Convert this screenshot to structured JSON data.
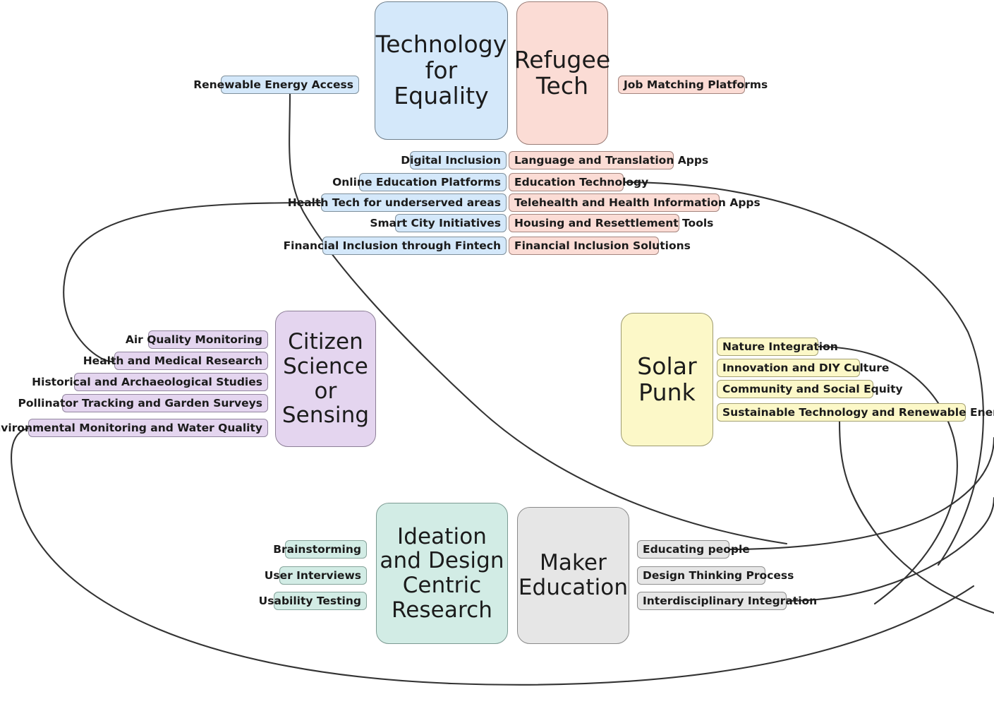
{
  "diagram": {
    "type": "mindmap",
    "background": "#ffffff",
    "edge_color": "#333333"
  },
  "palette": {
    "blue_fill": "#d4e8fa",
    "blue_stroke": "#6f7f8c",
    "pink_fill": "#fbdcd5",
    "pink_stroke": "#9a7d77",
    "purple_fill": "#e4d5ef",
    "purple_stroke": "#8d7f97",
    "yellow_fill": "#fcf8c8",
    "yellow_stroke": "#9d9a6f",
    "teal_fill": "#d2ece5",
    "teal_stroke": "#7c9a92",
    "grey_fill": "#e6e6e6",
    "grey_stroke": "#8a8a8a"
  },
  "branches": [
    {
      "id": "technology-for-equality",
      "title": "Technology\nfor\nEquality",
      "title_lines": [
        "Technology",
        "for",
        "Equality"
      ],
      "color": "blue",
      "leaves": [
        "Renewable Energy Access",
        "Digital Inclusion",
        "Online Education Platforms",
        "Health Tech for underserved areas",
        "Smart City Initiatives",
        "Financial Inclusion through Fintech"
      ]
    },
    {
      "id": "refugee-tech",
      "title_lines": [
        "Refugee",
        "Tech"
      ],
      "color": "pink",
      "leaves": [
        "Job Matching Platforms",
        "Language and Translation Apps",
        "Education Technology",
        "Telehealth and Health Information Apps",
        "Housing and Resettlement Tools",
        "Financial Inclusion Solutions"
      ]
    },
    {
      "id": "citizen-science-or-sensing",
      "title_lines": [
        "Citizen",
        "Science",
        "or",
        "Sensing"
      ],
      "color": "purple",
      "leaves": [
        "Air Quality Monitoring",
        "Health and Medical Research",
        "Historical and Archaeological Studies",
        "Pollinator Tracking and Garden Surveys",
        "Environmental Monitoring and Water Quality"
      ]
    },
    {
      "id": "solar-punk",
      "title_lines": [
        "Solar",
        "Punk"
      ],
      "color": "yellow",
      "leaves": [
        "Nature Integration",
        "Innovation and DIY Culture",
        "Community and Social Equity",
        "Sustainable Technology and Renewable Energy"
      ]
    },
    {
      "id": "ideation-and-design-centric-research",
      "title_lines": [
        "Ideation",
        "and Design",
        "Centric",
        "Research"
      ],
      "color": "teal",
      "leaves": [
        "Brainstorming",
        "User Interviews",
        "Usability Testing"
      ]
    },
    {
      "id": "maker-education",
      "title_lines": [
        "Maker",
        "Education"
      ],
      "color": "grey",
      "leaves": [
        "Educating people",
        "Design Thinking Process",
        "Interdisciplinary Integration"
      ]
    }
  ],
  "nodes": {
    "tech_for_equality": {
      "lines": [
        "Technology",
        "for",
        "Equality"
      ]
    },
    "refugee_tech": {
      "lines": [
        "Refugee",
        "Tech"
      ]
    },
    "citizen_science": {
      "lines": [
        "Citizen",
        "Science",
        "or",
        "Sensing"
      ]
    },
    "solar_punk": {
      "lines": [
        "Solar",
        "Punk"
      ]
    },
    "ideation": {
      "lines": [
        "Ideation",
        "and Design",
        "Centric",
        "Research"
      ]
    },
    "maker_education": {
      "lines": [
        "Maker",
        "Education"
      ]
    }
  },
  "leaves": {
    "renewable_energy_access": "Renewable Energy Access",
    "digital_inclusion": "Digital Inclusion",
    "online_education_platforms": "Online Education Platforms",
    "health_tech_underserved": "Health Tech for underserved areas",
    "smart_city_initiatives": "Smart City Initiatives",
    "financial_inclusion_fintech": "Financial Inclusion through Fintech",
    "job_matching_platforms": "Job Matching Platforms",
    "language_translation_apps": "Language and Translation Apps",
    "education_technology": "Education Technology",
    "telehealth_health_info_apps": "Telehealth and Health Information Apps",
    "housing_resettlement_tools": "Housing and Resettlement Tools",
    "financial_inclusion_solutions": "Financial Inclusion Solutions",
    "air_quality_monitoring": "Air Quality Monitoring",
    "health_medical_research": "Health and Medical Research",
    "historical_archaeological": "Historical and Archaeological Studies",
    "pollinator_tracking": "Pollinator Tracking and Garden Surveys",
    "environmental_monitoring": "Environmental Monitoring and Water Quality",
    "nature_integration": "Nature Integration",
    "innovation_diy_culture": "Innovation and DIY Culture",
    "community_social_equity": "Community and Social Equity",
    "sustainable_tech_renewable": "Sustainable Technology and Renewable Energy",
    "brainstorming": "Brainstorming",
    "user_interviews": "User Interviews",
    "usability_testing": "Usability Testing",
    "educating_people": "Educating people",
    "design_thinking_process": "Design Thinking Process",
    "interdisciplinary_integration": "Interdisciplinary Integration"
  }
}
